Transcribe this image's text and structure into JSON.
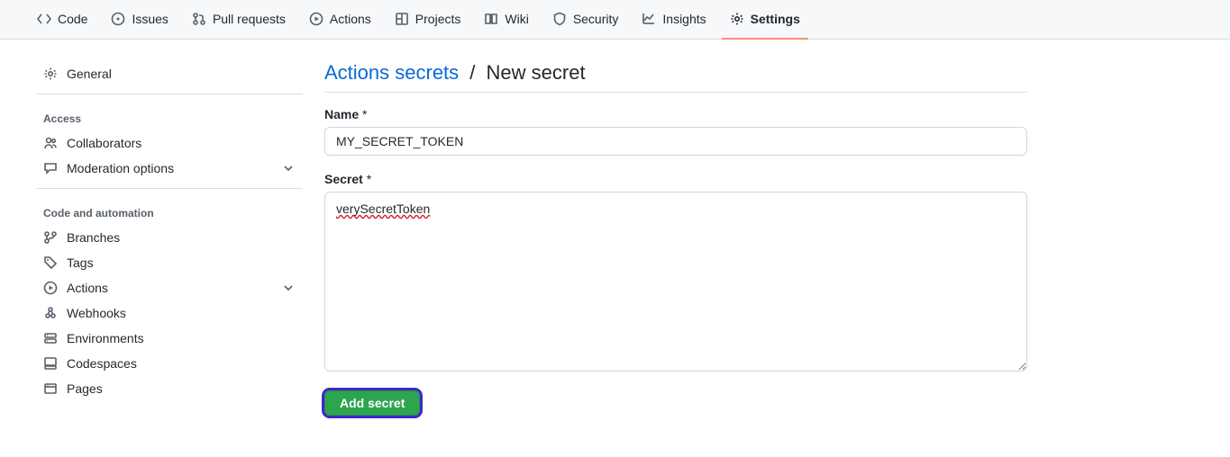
{
  "topnav": {
    "tabs": [
      {
        "label": "Code"
      },
      {
        "label": "Issues"
      },
      {
        "label": "Pull requests"
      },
      {
        "label": "Actions"
      },
      {
        "label": "Projects"
      },
      {
        "label": "Wiki"
      },
      {
        "label": "Security"
      },
      {
        "label": "Insights"
      },
      {
        "label": "Settings"
      }
    ]
  },
  "sidebar": {
    "general_label": "General",
    "groups": {
      "access": {
        "heading": "Access",
        "items": [
          {
            "label": "Collaborators"
          },
          {
            "label": "Moderation options",
            "expandable": true
          }
        ]
      },
      "code_automation": {
        "heading": "Code and automation",
        "items": [
          {
            "label": "Branches"
          },
          {
            "label": "Tags"
          },
          {
            "label": "Actions",
            "expandable": true
          },
          {
            "label": "Webhooks"
          },
          {
            "label": "Environments"
          },
          {
            "label": "Codespaces"
          },
          {
            "label": "Pages"
          }
        ]
      }
    }
  },
  "main": {
    "breadcrumb_link": "Actions secrets",
    "breadcrumb_sep": "/",
    "breadcrumb_current": "New secret",
    "name_label": "Name",
    "name_value": "MY_SECRET_TOKEN",
    "secret_label": "Secret",
    "secret_value": "verySecretToken",
    "required_marker": "*",
    "submit_label": "Add secret"
  }
}
